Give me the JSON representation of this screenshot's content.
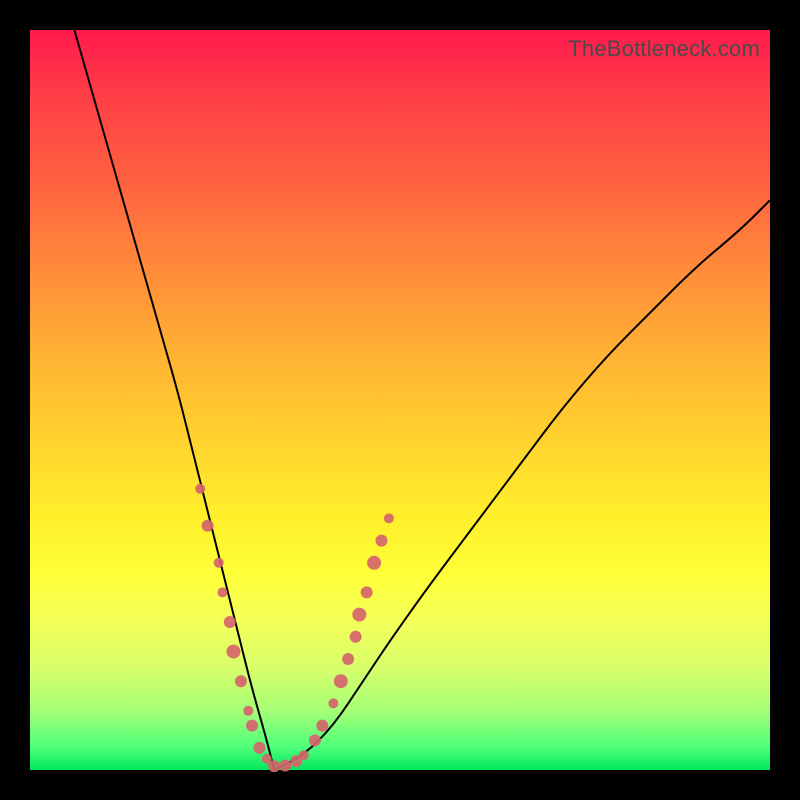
{
  "watermark": "TheBottleneck.com",
  "colors": {
    "background": "#000000",
    "curve_stroke": "#000000",
    "marker_fill": "#d5656b"
  },
  "chart_data": {
    "type": "line",
    "title": "",
    "xlabel": "",
    "ylabel": "",
    "xlim": [
      0,
      100
    ],
    "ylim": [
      0,
      100
    ],
    "grid": false,
    "legend": null,
    "description": "Bottleneck-style V-curve showing mismatch percentage (y) across component scale (x); minimum near the matched component. Descending left limb from top-left; ascending right limb toward upper-right. Salmon-colored markers cluster near the trough on both limbs.",
    "series": [
      {
        "name": "left_limb",
        "x": [
          6,
          8,
          10,
          12,
          14,
          16,
          18,
          20,
          22,
          24,
          26,
          28,
          30,
          32,
          33
        ],
        "y": [
          100,
          93,
          86,
          79,
          72,
          65,
          58,
          51,
          43,
          35,
          27,
          19,
          11,
          4,
          0
        ]
      },
      {
        "name": "right_limb",
        "x": [
          33,
          37,
          41,
          45,
          49,
          54,
          60,
          66,
          72,
          78,
          84,
          90,
          96,
          100
        ],
        "y": [
          0,
          2,
          6,
          12,
          18,
          25,
          33,
          41,
          49,
          56,
          62,
          68,
          73,
          77
        ]
      }
    ],
    "markers": {
      "name": "sampled points",
      "color": "#d5656b",
      "points": [
        {
          "x": 23,
          "y": 38,
          "r": 5
        },
        {
          "x": 24,
          "y": 33,
          "r": 6
        },
        {
          "x": 25.5,
          "y": 28,
          "r": 5
        },
        {
          "x": 26,
          "y": 24,
          "r": 5
        },
        {
          "x": 27,
          "y": 20,
          "r": 6
        },
        {
          "x": 27.5,
          "y": 16,
          "r": 7
        },
        {
          "x": 28.5,
          "y": 12,
          "r": 6
        },
        {
          "x": 29.5,
          "y": 8,
          "r": 5
        },
        {
          "x": 30,
          "y": 6,
          "r": 6
        },
        {
          "x": 31,
          "y": 3,
          "r": 6
        },
        {
          "x": 32,
          "y": 1.5,
          "r": 5
        },
        {
          "x": 33,
          "y": 0.5,
          "r": 6
        },
        {
          "x": 34.5,
          "y": 0.6,
          "r": 6
        },
        {
          "x": 36,
          "y": 1.2,
          "r": 6
        },
        {
          "x": 37,
          "y": 2,
          "r": 5
        },
        {
          "x": 38.5,
          "y": 4,
          "r": 6
        },
        {
          "x": 39.5,
          "y": 6,
          "r": 6
        },
        {
          "x": 41,
          "y": 9,
          "r": 5
        },
        {
          "x": 42,
          "y": 12,
          "r": 7
        },
        {
          "x": 43,
          "y": 15,
          "r": 6
        },
        {
          "x": 44,
          "y": 18,
          "r": 6
        },
        {
          "x": 44.5,
          "y": 21,
          "r": 7
        },
        {
          "x": 45.5,
          "y": 24,
          "r": 6
        },
        {
          "x": 46.5,
          "y": 28,
          "r": 7
        },
        {
          "x": 47.5,
          "y": 31,
          "r": 6
        },
        {
          "x": 48.5,
          "y": 34,
          "r": 5
        }
      ]
    }
  }
}
